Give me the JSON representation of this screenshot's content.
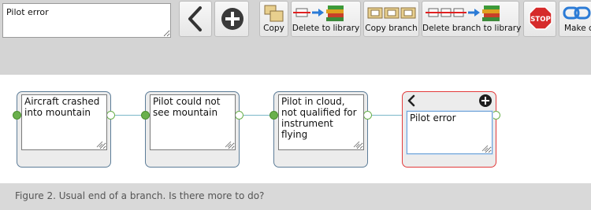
{
  "toolbar": {
    "note_text": "Pilot error",
    "back_icon": "chevron-left-icon",
    "add_icon": "plus-circle-icon",
    "copy_label": "Copy",
    "delete_to_library_label": "Delete to library",
    "copy_branch_label": "Copy branch",
    "delete_branch_to_library_label": "Delete branch to library",
    "stop_label": "STOP",
    "make_label": "Make c"
  },
  "nodes": [
    {
      "text": "Aircraft crashed into mountain"
    },
    {
      "text": "Pilot could not see mountain"
    },
    {
      "text": "Pilot in cloud, not qualified for instrument flying"
    },
    {
      "text": "Pilot error"
    }
  ],
  "caption": "Figure 2. Usual end of a branch. Is there more to do?",
  "colors": {
    "toolbar_bg": "#d4d4d4",
    "node_border": "#5d7d98",
    "active_border": "#e23b3b",
    "connector_dot": "#6ab04c",
    "stop_red": "#d62a2a"
  }
}
